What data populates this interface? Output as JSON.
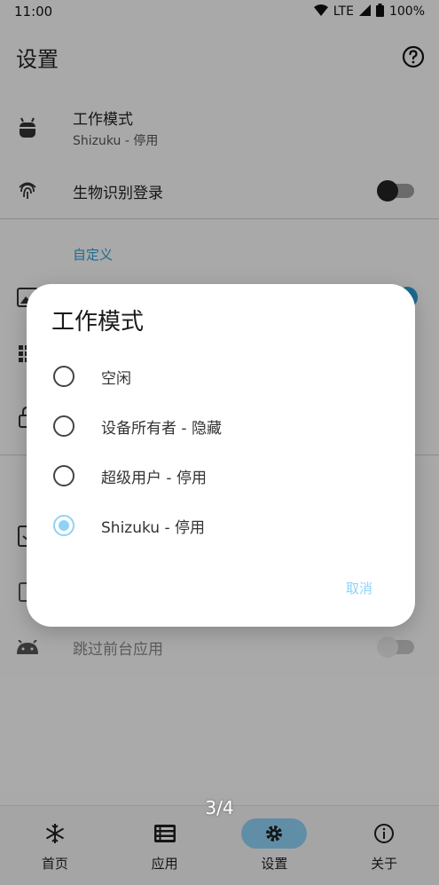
{
  "status_bar": {
    "time": "11:00",
    "network": "LTE",
    "battery": "100%"
  },
  "header": {
    "title": "设置"
  },
  "settings": {
    "work_mode": {
      "title": "工作模式",
      "value": "Shizuku - 停用"
    },
    "biometric": {
      "title": "生物识别登录"
    },
    "section_custom": "自定义",
    "skip_foreground": {
      "title": "跳过前台应用"
    }
  },
  "dialog": {
    "title": "工作模式",
    "options": [
      "空闲",
      "设备所有者 - 隐藏",
      "超级用户 - 停用",
      "Shizuku - 停用"
    ],
    "selected_index": 3,
    "cancel_label": "取消"
  },
  "page_indicator": "3/4",
  "bottom_nav": {
    "items": [
      {
        "label": "首页",
        "icon": "snowflake-icon"
      },
      {
        "label": "应用",
        "icon": "list-icon"
      },
      {
        "label": "设置",
        "icon": "gear-icon"
      },
      {
        "label": "关于",
        "icon": "info-icon"
      }
    ],
    "active_index": 2
  },
  "colors": {
    "accent": "#8fd2f7",
    "section_label": "#2a9fd6"
  }
}
